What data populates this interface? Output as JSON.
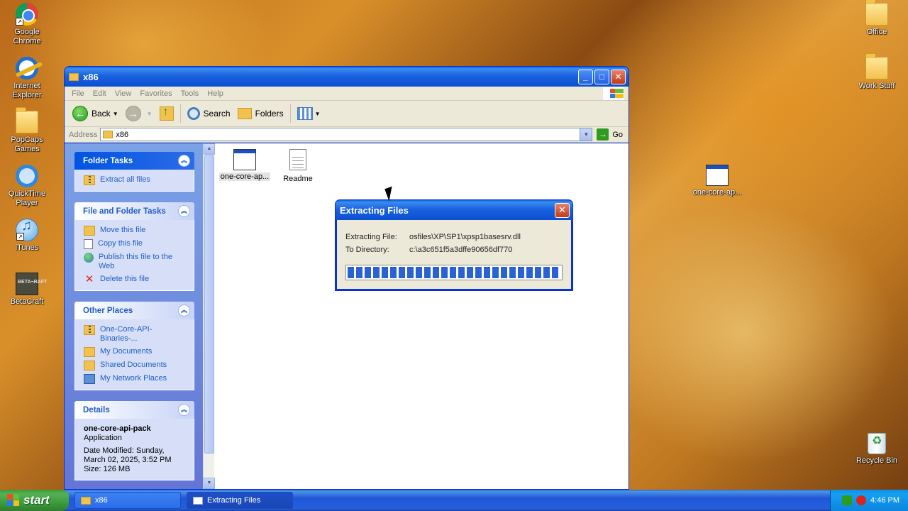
{
  "desktop": {
    "left_icons": [
      {
        "label": "Google Chrome",
        "icon": "chrome-icon"
      },
      {
        "label": "Internet Explorer",
        "icon": "internet-explorer-icon"
      },
      {
        "label": "PopCaps Games",
        "icon": "folder-icon"
      },
      {
        "label": "QuickTime Player",
        "icon": "quicktime-icon"
      },
      {
        "label": "iTunes",
        "icon": "itunes-icon"
      },
      {
        "label": "BetaCraft",
        "icon": "betacraft-icon"
      }
    ],
    "right_icons": [
      {
        "label": "Office",
        "icon": "folder-icon"
      },
      {
        "label": "Work Stuff",
        "icon": "folder-icon"
      },
      {
        "label": "one-core-ap...",
        "icon": "application-icon"
      },
      {
        "label": "Recycle Bin",
        "icon": "recycle-bin-icon"
      }
    ]
  },
  "explorer": {
    "title": "x86",
    "menu": [
      "File",
      "Edit",
      "View",
      "Favorites",
      "Tools",
      "Help"
    ],
    "toolbar": {
      "back_label": "Back",
      "search_label": "Search",
      "folders_label": "Folders"
    },
    "address": {
      "label": "Address",
      "value": "x86",
      "go_label": "Go"
    },
    "folder_tasks": {
      "title": "Folder Tasks",
      "items": [
        "Extract all files"
      ]
    },
    "file_folder_tasks": {
      "title": "File and Folder Tasks",
      "items": [
        "Move this file",
        "Copy this file",
        "Publish this file to the Web",
        "Delete this file"
      ]
    },
    "other_places": {
      "title": "Other Places",
      "items": [
        "One-Core-API-Binaries-...",
        "My Documents",
        "Shared Documents",
        "My Network Places"
      ]
    },
    "details": {
      "title": "Details",
      "name": "one-core-api-pack",
      "type": "Application",
      "modified": "Date Modified: Sunday, March 02, 2025, 3:52 PM",
      "size": "Size: 126 MB"
    },
    "files": [
      {
        "label": "one-core-ap...",
        "icon": "application-icon"
      },
      {
        "label": "Readme",
        "icon": "text-document-icon"
      }
    ]
  },
  "dialog": {
    "title": "Extracting Files",
    "extracting_label": "Extracting File:",
    "extracting_value": "osfiles\\XP\\SP1\\xpsp1basesrv.dll",
    "directory_label": "To Directory:",
    "directory_value": "c:\\a3c651f5a3dffe90656df770",
    "progress": 1.0
  },
  "taskbar": {
    "start_label": "start",
    "tasks": [
      {
        "label": "x86",
        "icon": "folder-icon"
      },
      {
        "label": "Extracting Files",
        "icon": "window-icon"
      }
    ],
    "clock": "4:46 PM"
  },
  "colors": {
    "xp_blue": "#0054e3",
    "start_green": "#3d9c3d",
    "tray_blue": "#0f8ee8"
  }
}
